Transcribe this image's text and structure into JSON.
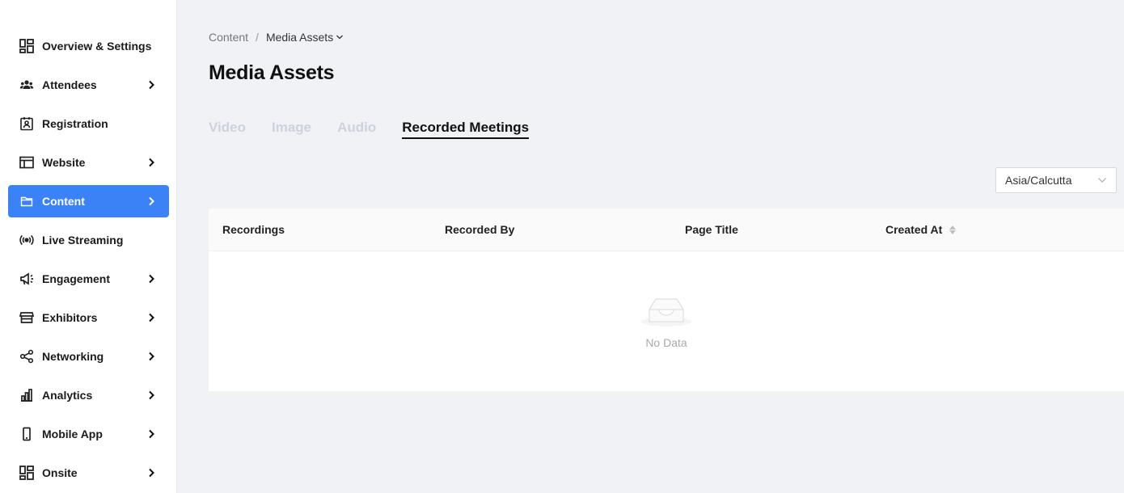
{
  "sidebar": {
    "items": [
      {
        "label": "Overview & Settings",
        "icon": "dashboard-icon",
        "has_chevron": false,
        "active": false
      },
      {
        "label": "Attendees",
        "icon": "people-icon",
        "has_chevron": true,
        "active": false
      },
      {
        "label": "Registration",
        "icon": "badge-icon",
        "has_chevron": false,
        "active": false
      },
      {
        "label": "Website",
        "icon": "browser-window-icon",
        "has_chevron": true,
        "active": false
      },
      {
        "label": "Content",
        "icon": "folder-icon",
        "has_chevron": true,
        "active": true
      },
      {
        "label": "Live Streaming",
        "icon": "broadcast-icon",
        "has_chevron": false,
        "active": false
      },
      {
        "label": "Engagement",
        "icon": "megaphone-icon",
        "has_chevron": true,
        "active": false
      },
      {
        "label": "Exhibitors",
        "icon": "storefront-icon",
        "has_chevron": true,
        "active": false
      },
      {
        "label": "Networking",
        "icon": "share-nodes-icon",
        "has_chevron": true,
        "active": false
      },
      {
        "label": "Analytics",
        "icon": "bar-chart-icon",
        "has_chevron": true,
        "active": false
      },
      {
        "label": "Mobile App",
        "icon": "mobile-phone-icon",
        "has_chevron": true,
        "active": false
      },
      {
        "label": "Onsite",
        "icon": "grid-icon",
        "has_chevron": true,
        "active": false
      }
    ]
  },
  "breadcrumb": {
    "parent": "Content",
    "separator": "/",
    "current": "Media Assets"
  },
  "page": {
    "title": "Media Assets"
  },
  "tabs": [
    {
      "label": "Video",
      "active": false
    },
    {
      "label": "Image",
      "active": false
    },
    {
      "label": "Audio",
      "active": false
    },
    {
      "label": "Recorded Meetings",
      "active": true
    }
  ],
  "timezone": {
    "selected": "Asia/Calcutta"
  },
  "table": {
    "columns": [
      "Recordings",
      "Recorded By",
      "Page Title",
      "Created At"
    ],
    "empty_text": "No Data"
  },
  "colors": {
    "accent": "#3b82f6",
    "background": "#f0f2f5",
    "tab_inactive": "#cdd3dc"
  }
}
